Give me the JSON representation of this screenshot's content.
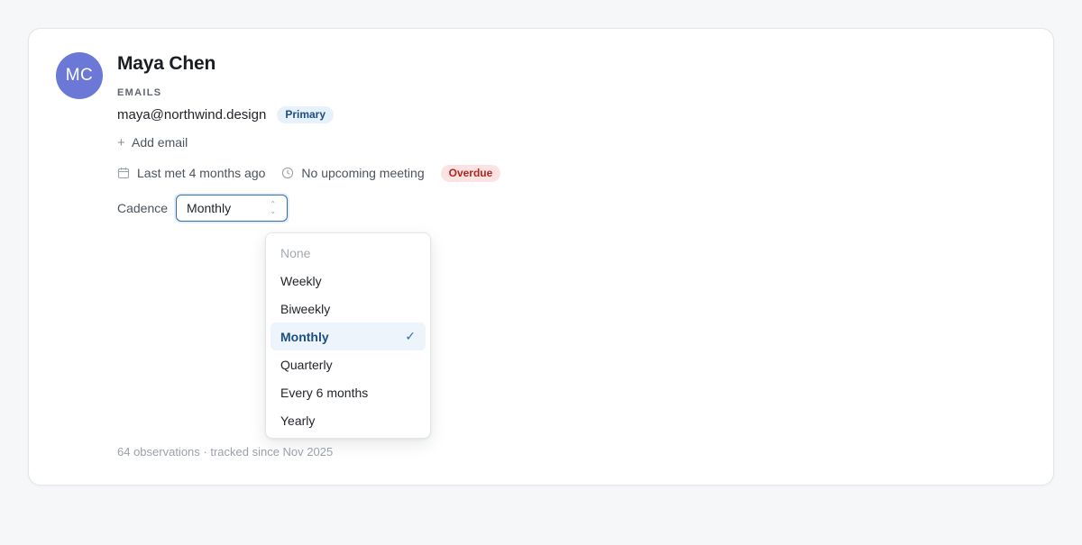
{
  "contact": {
    "initials": "MC",
    "name": "Maya Chen",
    "avatar_color": "#6b78d6"
  },
  "emails": {
    "section_label": "EMAILS",
    "items": [
      {
        "address": "maya@northwind.design",
        "badge": "Primary"
      }
    ],
    "add_label": "Add email"
  },
  "meta": {
    "last_met": "Last met 4 months ago",
    "upcoming": "No upcoming meeting",
    "status_badge": "Overdue",
    "status_color": "#b3261e"
  },
  "cadence": {
    "label": "Cadence",
    "selected": "Monthly",
    "options": [
      {
        "label": "None",
        "disabled": true
      },
      {
        "label": "Weekly"
      },
      {
        "label": "Biweekly"
      },
      {
        "label": "Monthly",
        "selected": true,
        "check": "✓"
      },
      {
        "label": "Quarterly"
      },
      {
        "label": "Every 6 months"
      },
      {
        "label": "Yearly"
      }
    ]
  },
  "footer": {
    "text": "64 observations · tracked since Nov 2025"
  },
  "colors": {
    "accent": "#2f6fb3",
    "primary_badge_bg": "#e7f1fb",
    "overdue_badge_bg": "#fbe3e3"
  }
}
